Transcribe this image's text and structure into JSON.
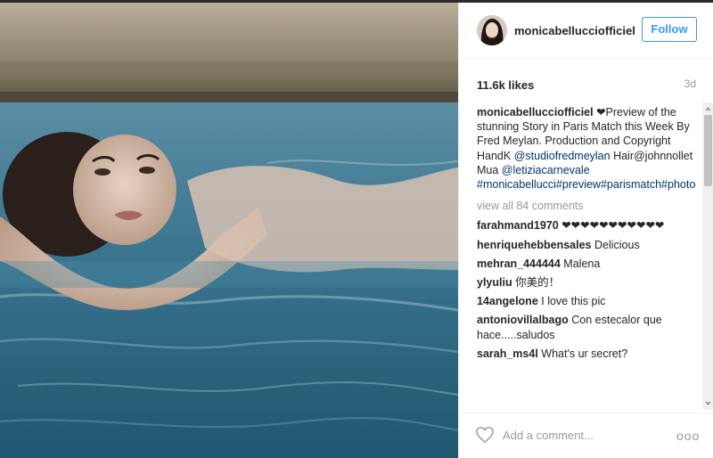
{
  "post": {
    "username": "monicabellucciofficiel",
    "follow_label": "Follow",
    "likes": "11.6k likes",
    "date": "3d",
    "caption_segments": [
      {
        "text": "monicabellucciofficiel",
        "kind": "user"
      },
      {
        "text": " ❤Preview of the stunning Story in Paris Match this Week By Fred Meylan. Production and Copyright HandK ",
        "kind": "text"
      },
      {
        "text": "@studiofredmeylan",
        "kind": "tag"
      },
      {
        "text": " Hair@johnnollet Mua ",
        "kind": "text"
      },
      {
        "text": "@letiziacarnevale",
        "kind": "tag"
      },
      {
        "text": " ",
        "kind": "text"
      },
      {
        "text": "#monicabellucci#preview#parismatch#photographer#fredmeylan#actress#swimmingpool#моникабелуччи#monica_bellucci#mostra#venezia#onthemilkyroad#emirkusturica#film",
        "kind": "tag"
      }
    ],
    "view_all": "view all 84 comments",
    "comments": [
      {
        "user": "farahmand1970",
        "text": "❤❤❤❤❤❤❤❤❤❤❤"
      },
      {
        "user": "henriquehebbensales",
        "text": "Delicious"
      },
      {
        "user": "mehran_444444",
        "text": "Malena"
      },
      {
        "user": "ylyuliu",
        "text": "你美的！"
      },
      {
        "user": "14angelone",
        "text": "I love this pic"
      },
      {
        "user": "antoniovillalbago",
        "text": "Con estecalor que hace.....saludos"
      },
      {
        "user": "sarah_ms4l",
        "text": "What's ur secret?"
      }
    ],
    "add_comment_placeholder": "Add a comment...",
    "more_label": "ooo"
  },
  "colors": {
    "link": "#003569",
    "follow_blue": "#3897f0",
    "muted": "#999999",
    "water": "#3d7690"
  },
  "icons": {
    "heart": "heart-outline-icon",
    "more": "more-options-icon"
  }
}
